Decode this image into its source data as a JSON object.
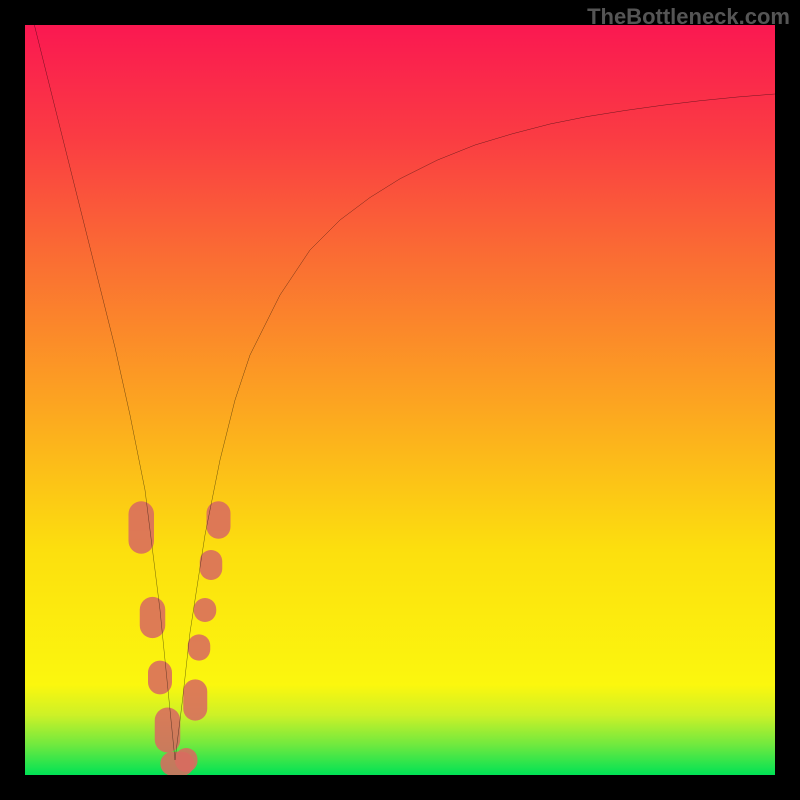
{
  "watermark": "TheBottleneck.com",
  "chart_data": {
    "type": "line",
    "title": "",
    "xlabel": "",
    "ylabel": "",
    "xlim": [
      0,
      100
    ],
    "ylim": [
      0,
      100
    ],
    "background_gradient": [
      {
        "y": 0,
        "color": "#00e255"
      },
      {
        "y": 4,
        "color": "#6fe93f"
      },
      {
        "y": 8,
        "color": "#cdf127"
      },
      {
        "y": 12,
        "color": "#fbf70e"
      },
      {
        "y": 30,
        "color": "#fcdf0e"
      },
      {
        "y": 50,
        "color": "#fca321"
      },
      {
        "y": 70,
        "color": "#fa6a34"
      },
      {
        "y": 85,
        "color": "#fa3c43"
      },
      {
        "y": 100,
        "color": "#fa1851"
      }
    ],
    "series": [
      {
        "name": "bottleneck-curve",
        "color": "#000000",
        "stroke_width": 2,
        "x": [
          0,
          2,
          4,
          6,
          8,
          10,
          12,
          14,
          16,
          18,
          19,
          20,
          21,
          22,
          24,
          26,
          28,
          30,
          34,
          38,
          42,
          46,
          50,
          55,
          60,
          65,
          70,
          75,
          80,
          85,
          90,
          95,
          100
        ],
        "y": [
          105,
          97,
          89,
          81,
          73,
          65,
          57,
          48,
          38,
          22,
          12,
          2,
          10,
          19,
          32,
          42,
          50,
          56,
          64,
          70,
          74,
          77,
          79.5,
          82,
          84,
          85.5,
          86.8,
          87.8,
          88.6,
          89.3,
          89.9,
          90.4,
          90.8
        ]
      }
    ],
    "markers": [
      {
        "name": "left-cluster",
        "color": "#d86b60",
        "shape": "capsule",
        "points": [
          {
            "x": 15.5,
            "y": 33,
            "w": 3.4,
            "h": 7.0
          },
          {
            "x": 17.0,
            "y": 21,
            "w": 3.4,
            "h": 5.5
          },
          {
            "x": 18.0,
            "y": 13,
            "w": 3.2,
            "h": 4.5
          },
          {
            "x": 19.0,
            "y": 6,
            "w": 3.4,
            "h": 6.0
          }
        ]
      },
      {
        "name": "valley-cluster",
        "color": "#d86b60",
        "shape": "capsule",
        "points": [
          {
            "x": 20.3,
            "y": 1.5,
            "w": 4.5,
            "h": 3.2
          },
          {
            "x": 21.5,
            "y": 2.0,
            "w": 3.0,
            "h": 3.2
          }
        ]
      },
      {
        "name": "right-cluster",
        "color": "#d86b60",
        "shape": "capsule",
        "points": [
          {
            "x": 22.7,
            "y": 10,
            "w": 3.2,
            "h": 5.5
          },
          {
            "x": 23.2,
            "y": 17,
            "w": 3.0,
            "h": 3.5
          },
          {
            "x": 24.0,
            "y": 22,
            "w": 3.0,
            "h": 3.2
          },
          {
            "x": 24.8,
            "y": 28,
            "w": 3.0,
            "h": 4.0
          },
          {
            "x": 25.8,
            "y": 34,
            "w": 3.2,
            "h": 5.0
          }
        ]
      }
    ]
  }
}
